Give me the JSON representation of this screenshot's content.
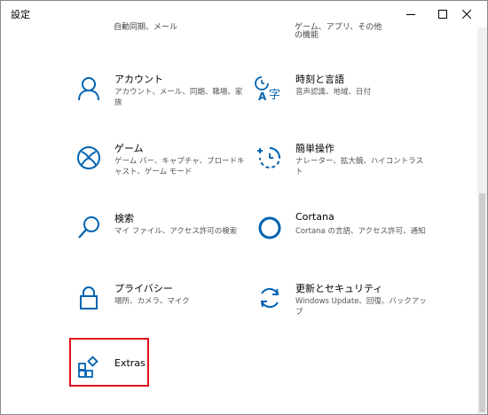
{
  "window": {
    "title": "設定"
  },
  "cutoff": {
    "right_line1": "ゲーム、アプリ、その他",
    "right_line2": "の機能",
    "left_line1": "自動同期、メール"
  },
  "tiles": [
    {
      "name": "アカウント",
      "desc": "アカウント、メール、同期、職場、家族",
      "icon": "person-icon"
    },
    {
      "name": "時刻と言語",
      "desc": "音声認識、地域、日付",
      "icon": "time-language-icon"
    },
    {
      "name": "ゲーム",
      "desc": "ゲーム バー、キャプチャ、ブロードキャスト、ゲーム モード",
      "icon": "xbox-icon"
    },
    {
      "name": "簡単操作",
      "desc": "ナレーター、拡大鏡、ハイコントラスト",
      "icon": "ease-of-access-icon"
    },
    {
      "name": "検索",
      "desc": "マイ ファイル、アクセス許可の検索",
      "icon": "search-icon"
    },
    {
      "name": "Cortana",
      "desc": "Cortana の言語、アクセス許可、通知",
      "icon": "cortana-icon"
    },
    {
      "name": "プライバシー",
      "desc": "場所、カメラ、マイク",
      "icon": "lock-icon"
    },
    {
      "name": "更新とセキュリティ",
      "desc": "Windows Update、回復、バックアップ",
      "icon": "sync-icon"
    },
    {
      "name": "Extras",
      "desc": "",
      "icon": "extras-icon"
    }
  ],
  "colors": {
    "accent": "#0063b1",
    "highlight": "#e0101b"
  }
}
